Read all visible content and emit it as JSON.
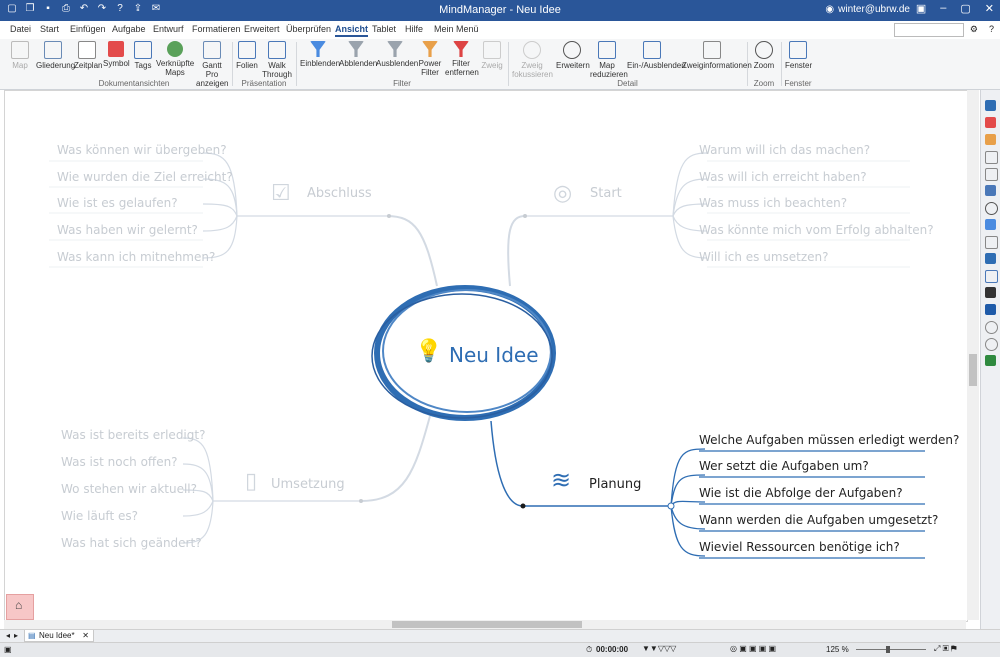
{
  "app": {
    "title": "MindManager - Neu Idee",
    "user": "winter@ubrw.de"
  },
  "tabs": [
    "Datei",
    "Start",
    "Einfügen",
    "Aufgabe",
    "Entwurf",
    "Formatieren",
    "Erweitert",
    "Überprüfen",
    "Ansicht",
    "Tablet",
    "Hilfe",
    "Mein Menü"
  ],
  "active_tab": "Ansicht",
  "ribbon": {
    "buttons": [
      {
        "label": "Map",
        "disabled": true
      },
      {
        "label": "Gliederung"
      },
      {
        "label": "Zeitplan"
      },
      {
        "label": "Symbol"
      },
      {
        "label": "Tags"
      },
      {
        "label": "Verknüpfte Maps"
      },
      {
        "label": "Gantt Pro anzeigen"
      },
      {
        "label": "Folien"
      },
      {
        "label": "Walk Through"
      },
      {
        "label": "Einblenden"
      },
      {
        "label": "Abblenden"
      },
      {
        "label": "Ausblenden"
      },
      {
        "label": "Power Filter"
      },
      {
        "label": "Filter entfernen"
      },
      {
        "label": "Zweig",
        "disabled": true
      },
      {
        "label": "Zweig fokussieren",
        "disabled": true
      },
      {
        "label": "Erweitern"
      },
      {
        "label": "Map reduzieren"
      },
      {
        "label": "Ein-/Ausblenden"
      },
      {
        "label": "Zweiginformationen"
      },
      {
        "label": "Zoom"
      },
      {
        "label": "Fenster"
      }
    ],
    "groups": [
      "Dokumentansichten",
      "Präsentation",
      "Filter",
      "Detail",
      "Zoom",
      "Fenster"
    ]
  },
  "map": {
    "central": "Neu Idee",
    "branches": {
      "abschluss": {
        "title": "Abschluss",
        "items": [
          "Was können wir übergeben?",
          "Wie wurden die Ziel erreicht?",
          "Wie ist es gelaufen?",
          "Was haben wir gelernt?",
          "Was kann ich mitnehmen?"
        ]
      },
      "start": {
        "title": "Start",
        "items": [
          "Warum will ich das machen?",
          "Was will ich erreicht haben?",
          "Was muss ich beachten?",
          "Was könnte mich vom Erfolg abhalten?",
          "Will ich es umsetzen?"
        ]
      },
      "umsetzung": {
        "title": "Umsetzung",
        "items": [
          "Was ist bereits erledigt?",
          "Was ist noch offen?",
          "Wo stehen wir aktuell?",
          "Wie läuft es?",
          "Was hat sich geändert?"
        ]
      },
      "planung": {
        "title": "Planung",
        "items": [
          "Welche Aufgaben müssen erledigt werden?",
          "Wer setzt die Aufgaben um?",
          "Wie ist die Abfolge der Aufgaben?",
          "Wann werden die Aufgaben umgesetzt?",
          "Wieviel Ressourcen benötige ich?"
        ]
      }
    }
  },
  "doc_tab": "Neu Idee*",
  "status": {
    "time": "00:00:00",
    "zoom": "125 %"
  },
  "colors": {
    "titlebar": "#2a5699",
    "accent": "#2e6db3",
    "faded": "#c7ccd2"
  }
}
